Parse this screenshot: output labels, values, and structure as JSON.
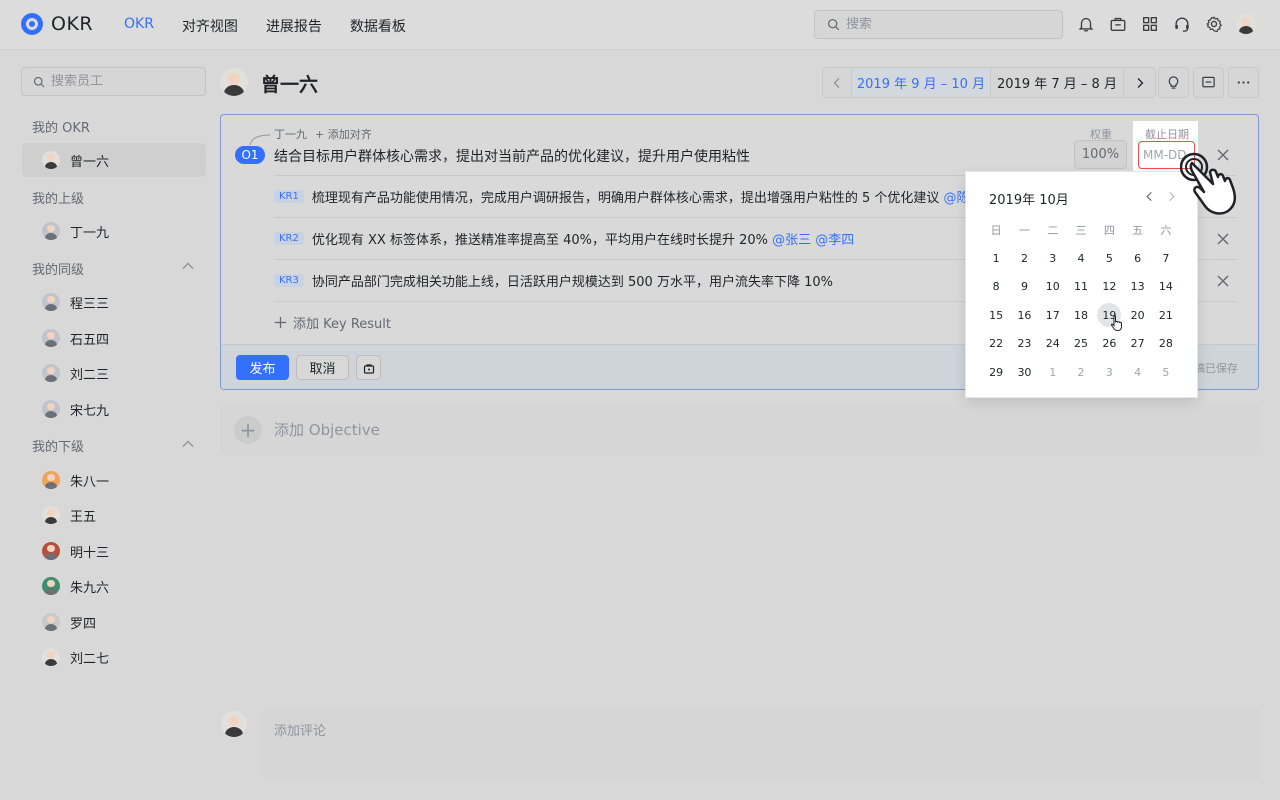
{
  "app": {
    "name": "OKR"
  },
  "nav": {
    "items": [
      "OKR",
      "对齐视图",
      "进展报告",
      "数据看板"
    ],
    "active": "OKR"
  },
  "search": {
    "placeholder": "搜索"
  },
  "topbar_icons": [
    "bell-icon",
    "briefcase-icon",
    "apps-grid-icon",
    "headset-icon",
    "settings-icon"
  ],
  "sidebar": {
    "search_placeholder": "搜索员工",
    "my_okr_title": "我的 OKR",
    "me": "曾一六",
    "superior_title": "我的上级",
    "superior": "丁一九",
    "peers_title": "我的同级",
    "peers": [
      "程三三",
      "石五四",
      "刘二三",
      "宋七九"
    ],
    "subordinates_title": "我的下级",
    "subordinates": [
      "朱八一",
      "王五",
      "明十三",
      "朱九六",
      "罗四",
      "刘二七"
    ]
  },
  "header": {
    "name": "曾一六",
    "periods": [
      "2019 年 9 月 – 10 月",
      "2019 年 7 月 – 8 月"
    ],
    "active_period": "2019 年 9 月 – 10 月"
  },
  "objective": {
    "align_owner": "丁一九",
    "add_align": "+ 添加对齐",
    "badge": "O1",
    "title": "结合目标用户群体核心需求，提出对当前产品的优化建议，提升用户使用粘性",
    "weight_label": "权重",
    "weight_value": "100%",
    "deadline_label": "截止日期",
    "deadline_placeholder": "MM-DD",
    "key_results": [
      {
        "tag": "KR1",
        "text": "梳理现有产品功能使用情况，完成用户调研报告，明确用户群体核心需求，提出增强用户粘性的 5 个优化建议 ",
        "mentions": "@陈五"
      },
      {
        "tag": "KR2",
        "text": "优化现有 XX 标签体系，推送精准率提高至 40%，平均用户在线时长提升 20% ",
        "mentions": "@张三 @李四"
      },
      {
        "tag": "KR3",
        "text": "协同产品部门完成相关功能上线，日活跃用户规模达到 500 万水平，用户流失率下降 10%",
        "mentions": ""
      }
    ],
    "add_kr": "添加 Key Result",
    "publish": "发布",
    "cancel": "取消",
    "draft_status": "稿已保存"
  },
  "add_objective": "添加 Objective",
  "calendar": {
    "title": "2019年 10月",
    "weekdays": [
      "日",
      "一",
      "二",
      "三",
      "四",
      "五",
      "六"
    ],
    "weeks": [
      [
        "1",
        "2",
        "3",
        "4",
        "5",
        "6",
        "7"
      ],
      [
        "8",
        "9",
        "10",
        "11",
        "12",
        "13",
        "14"
      ],
      [
        "15",
        "16",
        "17",
        "18",
        "19",
        "20",
        "21"
      ],
      [
        "22",
        "23",
        "24",
        "25",
        "26",
        "27",
        "28"
      ],
      [
        "29",
        "30",
        "1",
        "2",
        "3",
        "4",
        "5"
      ]
    ],
    "hovered": "19"
  },
  "comment": {
    "placeholder": "添加评论"
  },
  "colors": {
    "accent": "#3370ff",
    "error": "#f54a45"
  }
}
